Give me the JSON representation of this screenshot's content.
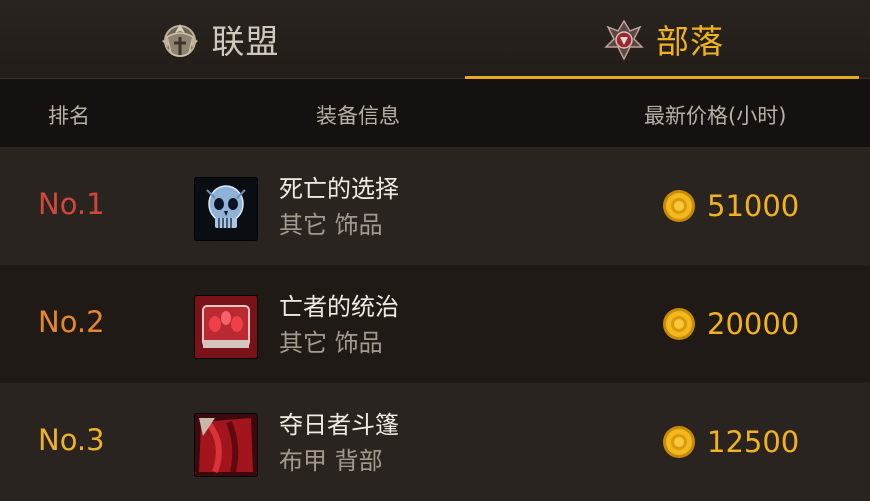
{
  "tabs": [
    {
      "label": "联盟",
      "active": false,
      "icon": "alliance-emblem-icon"
    },
    {
      "label": "部落",
      "active": true,
      "icon": "horde-emblem-icon"
    }
  ],
  "columns": {
    "rank": "排名",
    "info": "装备信息",
    "price": "最新价格(小时)"
  },
  "rows": [
    {
      "rank": "No.1",
      "rank_color": "#d2473b",
      "name": "死亡的选择",
      "type": "其它  饰品",
      "price": "51000",
      "icon": "skull-icon"
    },
    {
      "rank": "No.2",
      "rank_color": "#e8862b",
      "name": "亡者的统治",
      "type": "其它  饰品",
      "price": "20000",
      "icon": "crimson-gem-icon"
    },
    {
      "rank": "No.3",
      "rank_color": "#eeb22a",
      "name": "夺日者斗篷",
      "type": "布甲  背部",
      "price": "12500",
      "icon": "red-cloak-icon"
    }
  ],
  "colors": {
    "accent": "#e8a91c",
    "price": "#f2b21d",
    "background": "#221d19"
  }
}
